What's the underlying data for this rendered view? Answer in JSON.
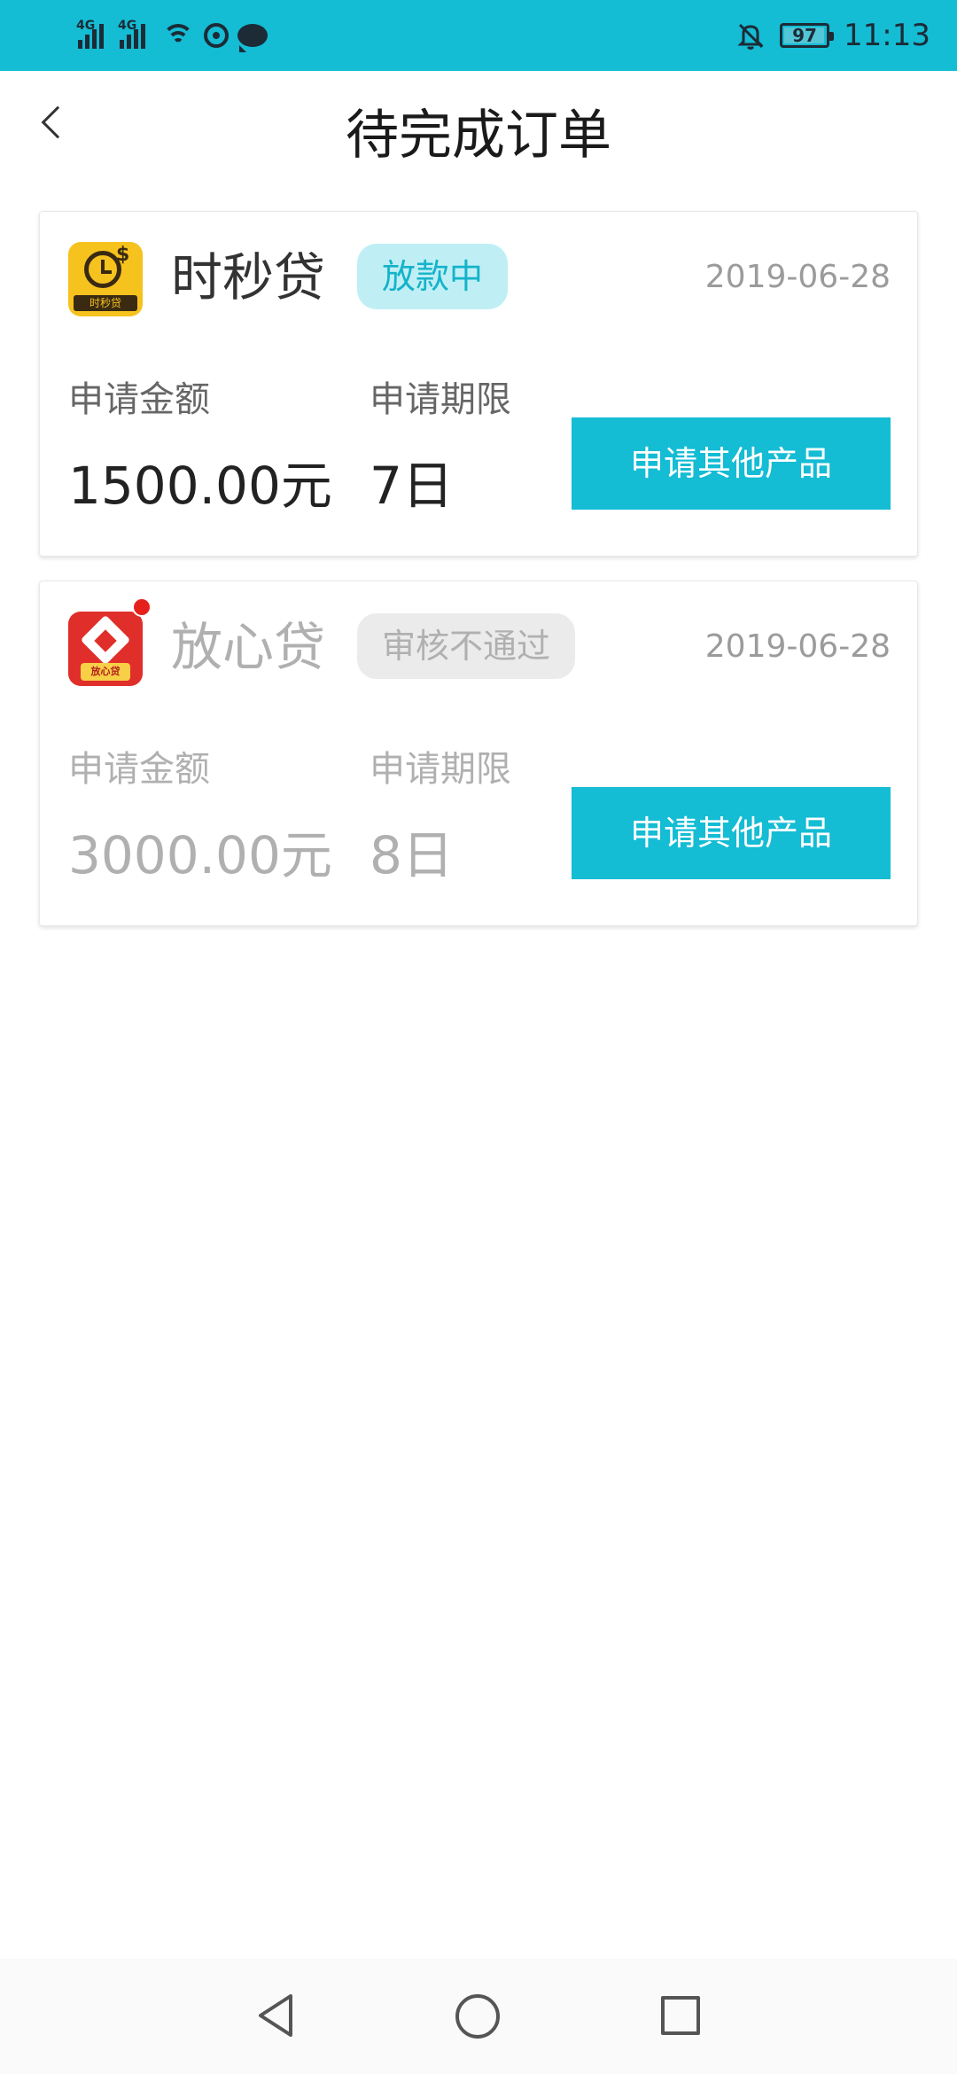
{
  "status_bar": {
    "signal_1_label": "4G",
    "signal_2_label": "4G",
    "battery_level": "97",
    "time": "11:13"
  },
  "header": {
    "title": "待完成订单"
  },
  "orders": [
    {
      "app_name": "时秒贷",
      "logo_band_text": "时秒贷",
      "status": "放款中",
      "date": "2019-06-28",
      "amount_label": "申请金额",
      "amount_value": "1500.00元",
      "term_label": "申请期限",
      "term_value": "7日",
      "action_label": "申请其他产品"
    },
    {
      "app_name": "放心贷",
      "logo_band_text": "放心贷",
      "status": "审核不通过",
      "date": "2019-06-28",
      "amount_label": "申请金额",
      "amount_value": "3000.00元",
      "term_label": "申请期限",
      "term_value": "8日",
      "action_label": "申请其他产品"
    }
  ],
  "colors": {
    "accent": "#14bcd4",
    "pill_active_bg": "#bfeff5",
    "pill_rejected_bg": "#ebebeb",
    "notification_dot": "#e6211b"
  },
  "icons": {
    "back": "chevron-left-icon",
    "nav_back": "triangle-back-icon",
    "nav_home": "circle-home-icon",
    "nav_recent": "square-recent-icon"
  }
}
